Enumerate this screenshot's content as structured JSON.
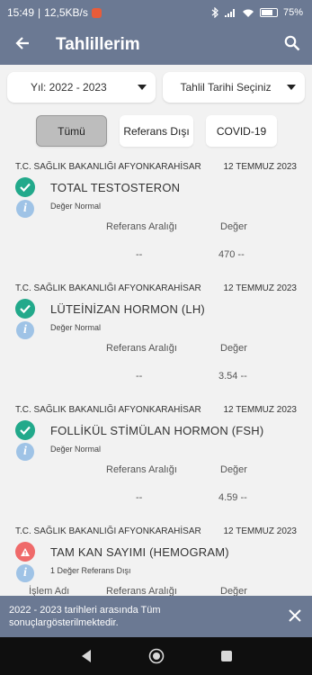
{
  "status_bar": {
    "time": "15:49",
    "speed": "12,5KB/s",
    "battery": "75%"
  },
  "app_bar": {
    "title": "Tahlillerim"
  },
  "filters": {
    "year_label": "Yıl: 2022 - 2023",
    "date_label": "Tahlil Tarihi Seçiniz"
  },
  "tabs": [
    {
      "label": "Tümü",
      "active": true
    },
    {
      "label": "Referans Dışı",
      "active": false
    },
    {
      "label": "COVID-19",
      "active": false
    }
  ],
  "columns": {
    "process": "İşlem Adı",
    "reference": "Referans Aralığı",
    "value": "Değer"
  },
  "results": [
    {
      "institution": "T.C. SAĞLIK BAKANLIĞI AFYONKARAHİSAR",
      "date": "12 TEMMUZ 2023",
      "name": "TOTAL TESTOSTERON",
      "status": "ok",
      "note": "Değer Normal",
      "reference": "--",
      "value": "470 --"
    },
    {
      "institution": "T.C. SAĞLIK BAKANLIĞI AFYONKARAHİSAR",
      "date": "12 TEMMUZ 2023",
      "name": "LÜTEİNİZAN HORMON (LH)",
      "status": "ok",
      "note": "Değer Normal",
      "reference": "--",
      "value": "3.54 --"
    },
    {
      "institution": "T.C. SAĞLIK BAKANLIĞI AFYONKARAHİSAR",
      "date": "12 TEMMUZ 2023",
      "name": "FOLLİKÜL STİMÜLAN HORMON (FSH)",
      "status": "ok",
      "note": "Değer Normal",
      "reference": "--",
      "value": "4.59 --"
    },
    {
      "institution": "T.C. SAĞLIK BAKANLIĞI AFYONKARAHİSAR",
      "date": "12 TEMMUZ 2023",
      "name": "TAM KAN SAYIMI (HEMOGRAM)",
      "status": "warn",
      "note": "1 Değer Referans Dışı"
    }
  ],
  "snackbar": {
    "message": "2022 - 2023 tarihleri arasında Tüm sonuçlargösterilmektedir."
  }
}
